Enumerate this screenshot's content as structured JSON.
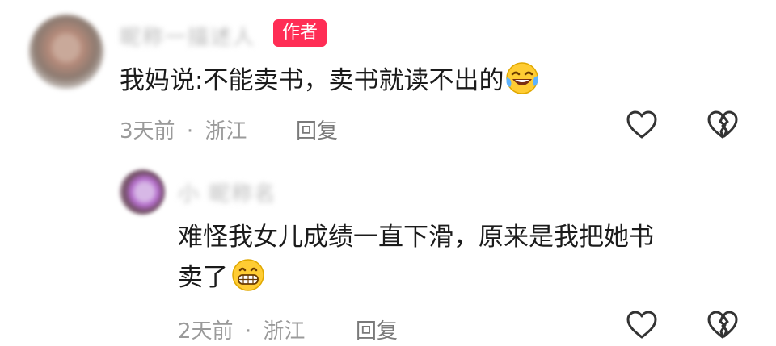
{
  "comment1": {
    "username": "昵称一描述人",
    "author_badge": "作者",
    "text": "我妈说:不能卖书，卖书就读不出的",
    "emoji": "rolling-laughing-emoji",
    "time": "3天前",
    "separator": "·",
    "location": "浙江",
    "reply_label": "回复"
  },
  "comment2": {
    "username": "小 昵称名",
    "text_line1": "难怪我女儿成绩一直下滑，原来是我把她书",
    "text_line2": "卖了",
    "emoji": "grinning-emoji",
    "time": "2天前",
    "separator": "·",
    "location": "浙江",
    "reply_label": "回复"
  },
  "icons": {
    "like": "heart-outline-icon",
    "dislike": "broken-heart-icon",
    "badge_color": "#ff2d55"
  }
}
